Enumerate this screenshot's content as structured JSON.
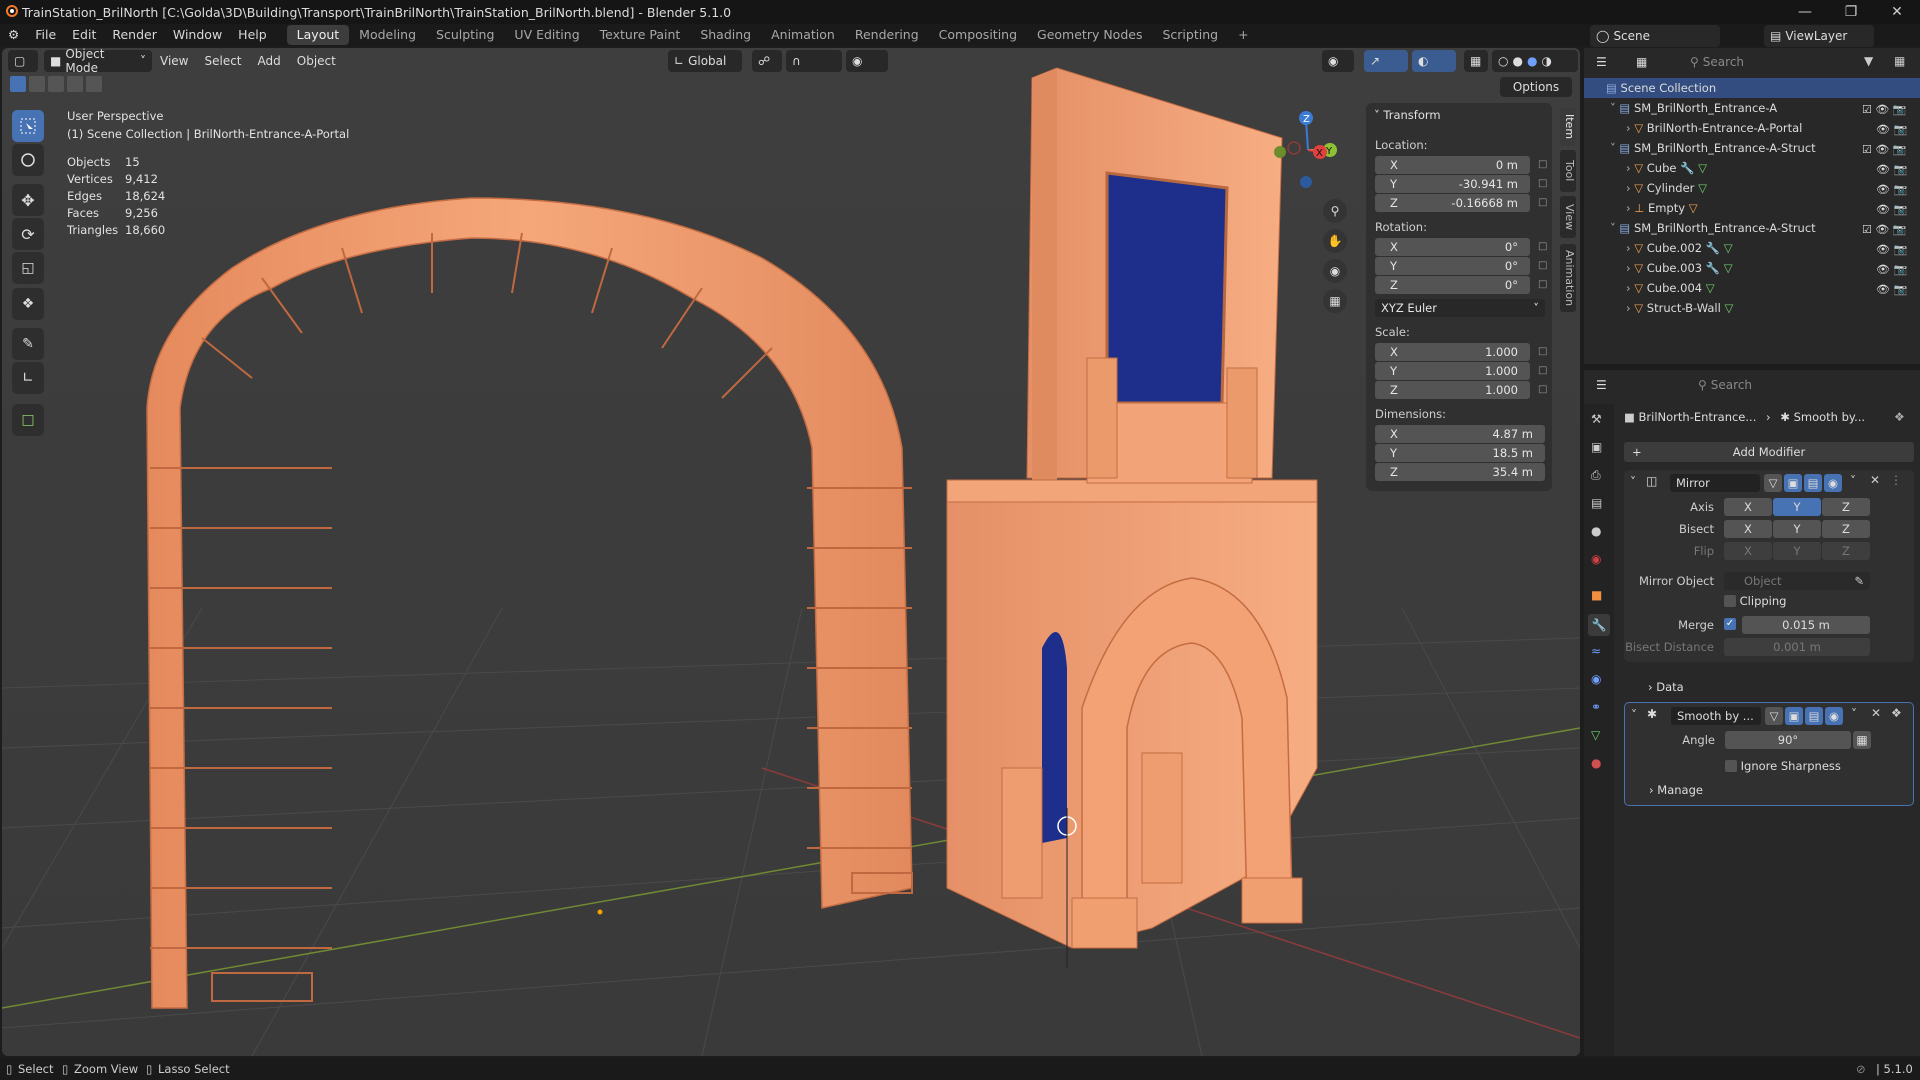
{
  "window": {
    "title": "TrainStation_BrilNorth [C:\\Golda\\3D\\Building\\Transport\\TrainBrilNorth\\TrainStation_BrilNorth.blend] - Blender 5.1.0"
  },
  "menu": [
    "File",
    "Edit",
    "Render",
    "Window",
    "Help"
  ],
  "workspaces": [
    "Layout",
    "Modeling",
    "Sculpting",
    "UV Editing",
    "Texture Paint",
    "Shading",
    "Animation",
    "Rendering",
    "Compositing",
    "Geometry Nodes",
    "Scripting"
  ],
  "scene": {
    "scene_name": "Scene",
    "view_layer": "ViewLayer"
  },
  "viewport_header": {
    "mode": "Object Mode",
    "menus": [
      "View",
      "Select",
      "Add",
      "Object"
    ],
    "orientation": "Global",
    "options": "Options"
  },
  "overlay": {
    "perspective": "User Perspective",
    "collection": "(1) Scene Collection | BrilNorth-Entrance-A-Portal",
    "stats": [
      {
        "k": "Objects",
        "v": "15"
      },
      {
        "k": "Vertices",
        "v": "9,412"
      },
      {
        "k": "Edges",
        "v": "18,624"
      },
      {
        "k": "Faces",
        "v": "9,256"
      },
      {
        "k": "Triangles",
        "v": "18,660"
      }
    ]
  },
  "gizmo": {
    "z": "Z",
    "y": "Y",
    "x": "X"
  },
  "npanel": {
    "title": "Transform",
    "location_label": "Location:",
    "rotation_label": "Rotation:",
    "scale_label": "Scale:",
    "dimensions_label": "Dimensions:",
    "location": [
      {
        "a": "X",
        "v": "0 m"
      },
      {
        "a": "Y",
        "v": "-30.941 m"
      },
      {
        "a": "Z",
        "v": "-0.16668 m"
      }
    ],
    "rotation": [
      {
        "a": "X",
        "v": "0°"
      },
      {
        "a": "Y",
        "v": "0°"
      },
      {
        "a": "Z",
        "v": "0°"
      }
    ],
    "euler": "XYZ Euler",
    "scale": [
      {
        "a": "X",
        "v": "1.000"
      },
      {
        "a": "Y",
        "v": "1.000"
      },
      {
        "a": "Z",
        "v": "1.000"
      }
    ],
    "dimensions": [
      {
        "a": "X",
        "v": "4.87 m"
      },
      {
        "a": "Y",
        "v": "18.5 m"
      },
      {
        "a": "Z",
        "v": "35.4 m"
      }
    ],
    "tabs": [
      "Item",
      "Tool",
      "View",
      "Animation"
    ]
  },
  "outliner": {
    "search_placeholder": "Search",
    "root": "Scene Collection",
    "rows": [
      {
        "label": "SM_BrilNorth_Entrance-A",
        "kind": "collection"
      },
      {
        "label": "BrilNorth-Entrance-A-Portal",
        "kind": "mesh"
      },
      {
        "label": "SM_BrilNorth_Entrance-A-Struct",
        "kind": "collection"
      },
      {
        "label": "Cube",
        "kind": "mesh"
      },
      {
        "label": "Cylinder",
        "kind": "mesh"
      },
      {
        "label": "Empty",
        "kind": "empty"
      },
      {
        "label": "SM_BrilNorth_Entrance-A-Struct",
        "kind": "collection"
      },
      {
        "label": "Cube.002",
        "kind": "mesh"
      },
      {
        "label": "Cube.003",
        "kind": "mesh"
      },
      {
        "label": "Cube.004",
        "kind": "mesh"
      },
      {
        "label": "Struct-B-Wall",
        "kind": "mesh"
      }
    ]
  },
  "properties": {
    "search_placeholder": "Search",
    "breadcrumb_obj": "BrilNorth-Entrance...",
    "breadcrumb_mod": "Smooth by...",
    "add_modifier": "Add Modifier",
    "mirror": {
      "name": "Mirror",
      "axis_label": "Axis",
      "bisect_label": "Bisect",
      "flip_label": "Flip",
      "axes": [
        "X",
        "Y",
        "Z"
      ],
      "mirror_object_label": "Mirror Object",
      "mirror_object_placeholder": "Object",
      "clipping": "Clipping",
      "merge_label": "Merge",
      "merge_value": "0.015 m",
      "bisect_distance_label": "Bisect Distance",
      "bisect_distance_value": "0.001 m",
      "data": "Data"
    },
    "smooth": {
      "name": "Smooth by ...",
      "angle_label": "Angle",
      "angle_value": "90°",
      "ignore_sharpness": "Ignore Sharpness",
      "manage": "Manage"
    }
  },
  "status": {
    "select": "Select",
    "zoom": "Zoom View",
    "lasso": "Lasso Select",
    "version": "5.1.0"
  },
  "colors": {
    "accent": "#4772b3",
    "mesh_orange": "#f1a072",
    "bg": "#3d3d3d",
    "panel": "#303030"
  }
}
